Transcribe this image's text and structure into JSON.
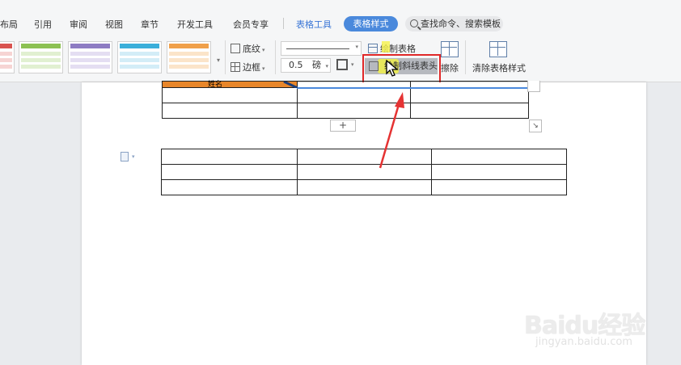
{
  "menu": {
    "items": [
      "布局",
      "引用",
      "审阅",
      "视图",
      "章节",
      "开发工具",
      "会员专享"
    ],
    "table_tools": "表格工具",
    "table_style": "表格样式",
    "search": "查找命令、搜索模板"
  },
  "ribbon": {
    "shading": "底纹",
    "border": "边框",
    "line_width": "0.5",
    "line_unit": "磅",
    "draw_table": "绘制表格",
    "diagonal_header": "绘制斜线表头",
    "erase": "擦除",
    "clear_style": "清除表格样式",
    "style_colors": [
      "#d9534f",
      "#8cc152",
      "#8e7cc3",
      "#3bafda",
      "#f0a04a"
    ]
  },
  "document": {
    "header_cell_text": "姓名",
    "add_row_symbol": "+",
    "resize_symbol": "↘"
  },
  "watermark": {
    "title": "Baidu经验",
    "url": "jingyan.baidu.com"
  }
}
